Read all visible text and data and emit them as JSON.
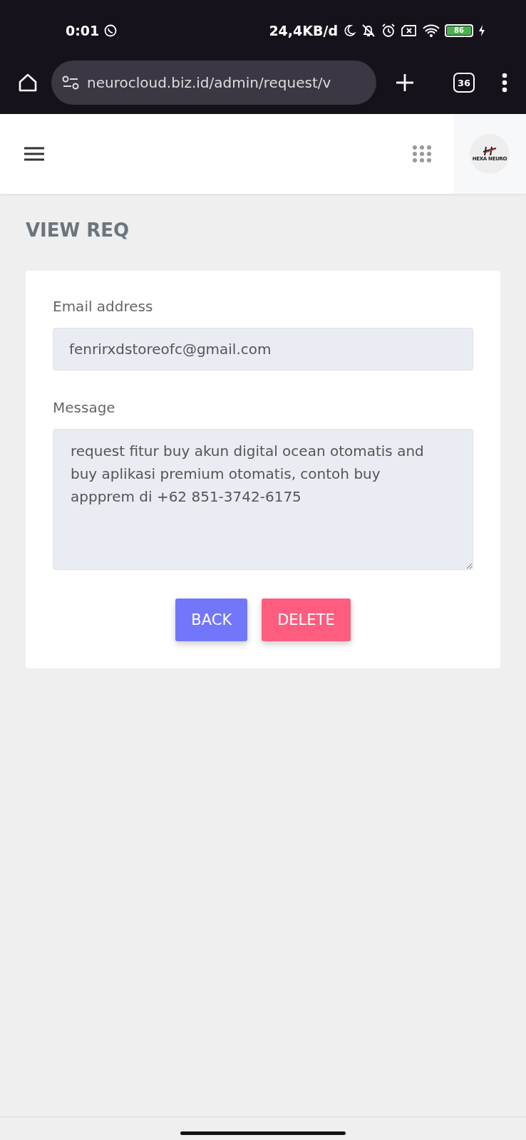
{
  "status_bar": {
    "time": "0:01",
    "net_speed": "24,4KB/d",
    "battery": "86"
  },
  "browser": {
    "url": "neurocloud.biz.id/admin/request/v",
    "tab_count": "36"
  },
  "header": {
    "logo_text": "HEXA NEURO"
  },
  "page_title": "VIEW REQ",
  "form": {
    "fields": [
      {
        "kind": "input",
        "label": "Email address",
        "value": "fenrirxdstoreofc@gmail.com"
      },
      {
        "kind": "textarea",
        "label": "Message",
        "value": "request fitur buy akun digital ocean otomatis and buy aplikasi premium otomatis, contoh buy appprem di +62 851-3742-6175"
      }
    ],
    "buttons": [
      {
        "label": "BACK",
        "kind": "primary"
      },
      {
        "label": "DELETE",
        "kind": "danger"
      }
    ]
  }
}
